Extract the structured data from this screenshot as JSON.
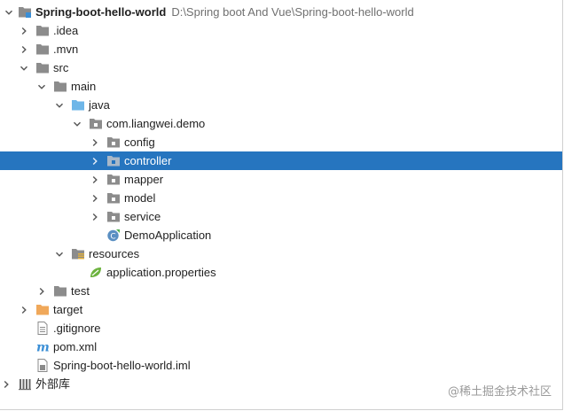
{
  "project": {
    "name": "Spring-boot-hello-world",
    "path": "D:\\Spring boot And Vue\\Spring-boot-hello-world"
  },
  "tree": {
    "idea": ".idea",
    "mvn": ".mvn",
    "src": "src",
    "main": "main",
    "java": "java",
    "package": "com.liangwei.demo",
    "config": "config",
    "controller": "controller",
    "mapper": "mapper",
    "model": "model",
    "service": "service",
    "demo_application": "DemoApplication",
    "resources": "resources",
    "application_properties": "application.properties",
    "test": "test",
    "target": "target",
    "gitignore": ".gitignore",
    "pom": "pom.xml",
    "iml": "Spring-boot-hello-world.iml",
    "external_libraries": "外部库"
  },
  "selected_item": "controller",
  "watermark": "@稀土掘金技术社区",
  "colors": {
    "selection": "#2675bf",
    "folder_gray": "#8c8c8c",
    "source_folder": "#6eb6e8",
    "target_folder": "#f0a85a",
    "maven_blue": "#3b8fd6"
  }
}
